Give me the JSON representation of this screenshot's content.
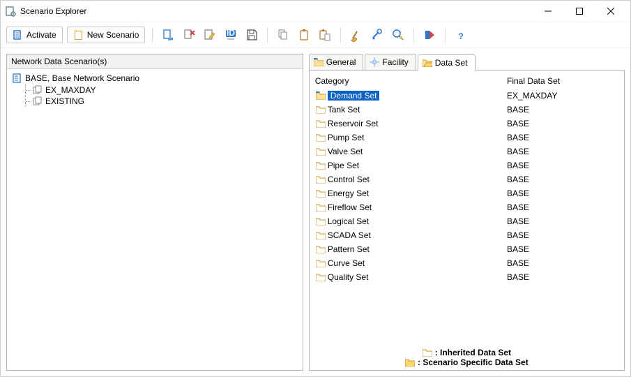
{
  "window": {
    "title": "Scenario Explorer"
  },
  "toolbar": {
    "activate": "Activate",
    "new_scenario": "New Scenario"
  },
  "left": {
    "header": "Network Data Scenario(s)",
    "root": "BASE, Base Network Scenario",
    "children": [
      "EX_MAXDAY",
      "EXISTING"
    ]
  },
  "tabs": {
    "general": "General",
    "facility": "Facility",
    "dataset": "Data Set"
  },
  "table": {
    "col_category": "Category",
    "col_final": "Final Data Set",
    "rows": [
      {
        "category": "Demand Set",
        "value": "EX_MAXDAY",
        "selected": true,
        "specific": true
      },
      {
        "category": "Tank Set",
        "value": "BASE"
      },
      {
        "category": "Reservoir Set",
        "value": "BASE"
      },
      {
        "category": "Pump Set",
        "value": "BASE"
      },
      {
        "category": "Valve Set",
        "value": "BASE"
      },
      {
        "category": "Pipe Set",
        "value": "BASE"
      },
      {
        "category": "Control Set",
        "value": "BASE"
      },
      {
        "category": "Energy Set",
        "value": "BASE"
      },
      {
        "category": "Fireflow Set",
        "value": "BASE"
      },
      {
        "category": "Logical Set",
        "value": "BASE"
      },
      {
        "category": "SCADA Set",
        "value": "BASE"
      },
      {
        "category": "Pattern Set",
        "value": "BASE"
      },
      {
        "category": "Curve Set",
        "value": "BASE"
      },
      {
        "category": "Quality Set",
        "value": "BASE"
      }
    ]
  },
  "legend": {
    "inherited": ": Inherited Data Set",
    "specific": ": Scenario Specific Data Set"
  },
  "icons": {
    "activate": "activate-icon",
    "new": "new-icon",
    "import": "import-icon",
    "delete": "delete-icon",
    "edit": "edit-icon",
    "id": "id-icon",
    "save": "save-icon",
    "copy": "copy-icon",
    "clipboard": "clipboard-icon",
    "paste": "paste-icon",
    "clean": "broom-icon",
    "wrench": "wrench-icon",
    "search": "search-icon",
    "run": "run-icon",
    "help": "help-icon"
  }
}
